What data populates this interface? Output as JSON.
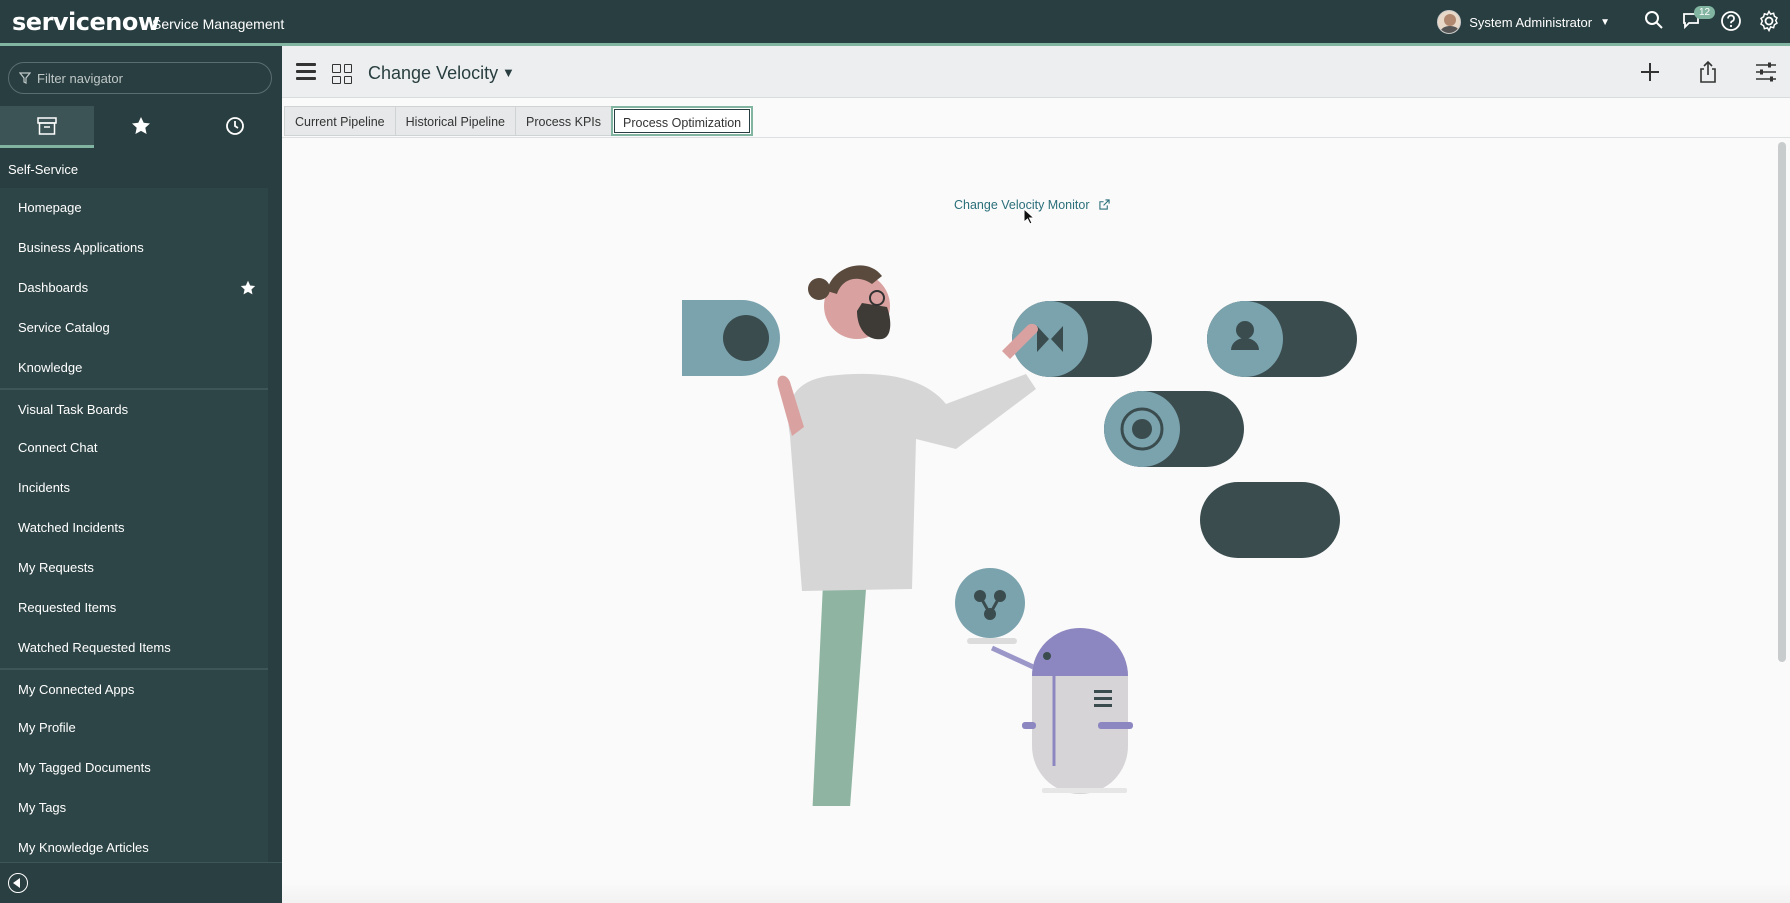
{
  "banner": {
    "brand": "servicenow",
    "subtitle": "Service Management",
    "user_name": "System Administrator",
    "notification_count": "12",
    "icons": [
      "search-icon",
      "chat-icon",
      "help-icon",
      "gear-icon"
    ]
  },
  "sidebar": {
    "filter_placeholder": "Filter navigator",
    "tabs": [
      "all-apps-icon",
      "favorites-star-icon",
      "history-clock-icon"
    ],
    "section": "Self-Service",
    "items": [
      {
        "label": "Homepage"
      },
      {
        "label": "Business Applications"
      },
      {
        "label": "Dashboards",
        "favorite": true
      },
      {
        "label": "Service Catalog"
      },
      {
        "label": "Knowledge"
      },
      {
        "label": "Visual Task Boards"
      },
      {
        "label": "Connect Chat"
      },
      {
        "label": "Incidents"
      },
      {
        "label": "Watched Incidents"
      },
      {
        "label": "My Requests"
      },
      {
        "label": "Requested Items"
      },
      {
        "label": "Watched Requested Items"
      },
      {
        "label": "My Connected Apps"
      },
      {
        "label": "My Profile"
      },
      {
        "label": "My Tagged Documents"
      },
      {
        "label": "My Tags"
      },
      {
        "label": "My Knowledge Articles"
      }
    ]
  },
  "header": {
    "title": "Change Velocity"
  },
  "tabs": [
    {
      "label": "Current Pipeline"
    },
    {
      "label": "Historical Pipeline"
    },
    {
      "label": "Process KPIs"
    },
    {
      "label": "Process Optimization",
      "active": true
    }
  ],
  "main": {
    "link_text": "Change Velocity Monitor"
  },
  "colors": {
    "banner": "#293e40",
    "accent": "#81b5a1",
    "link": "#2b6f7a"
  }
}
